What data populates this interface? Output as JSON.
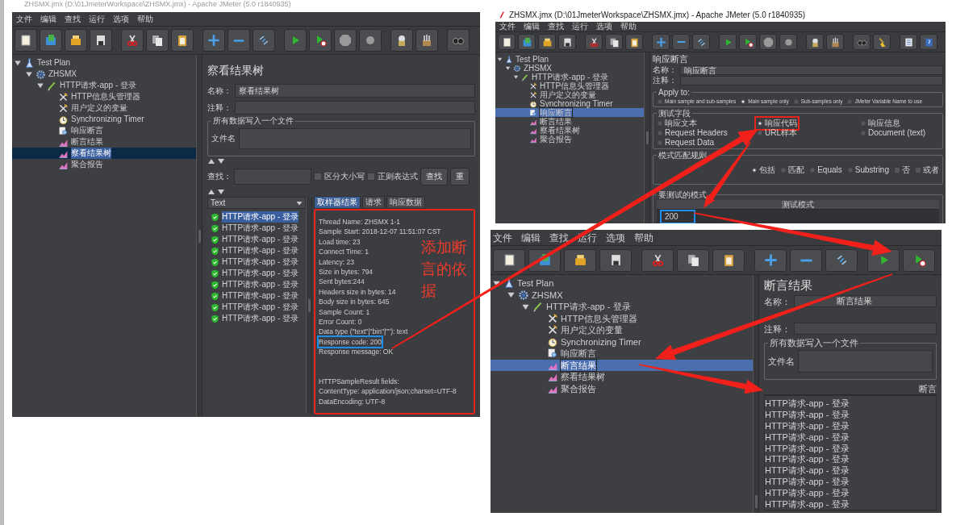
{
  "page_header": "ZHSMX.jmx (D:\\01JmeterWorkspace\\ZHSMX.jmx) - Apache JMeter (5.0 r1840935)",
  "windows": [
    {
      "kind": "view_results_tree",
      "menu": [
        "文件",
        "编辑",
        "查找",
        "运行",
        "选项",
        "帮助"
      ],
      "tree": [
        {
          "label": "Test Plan",
          "kind": "testplan",
          "expanded": true,
          "selected": false,
          "children": [
            {
              "label": "ZHSMX",
              "kind": "threadgroup",
              "expanded": true,
              "selected": false,
              "children": [
                {
                  "label": "HTTP请求-app - 登录",
                  "kind": "sampler",
                  "expanded": true,
                  "selected": false,
                  "children": [
                    {
                      "label": "HTTP信息头管理器",
                      "kind": "config",
                      "selected": false
                    },
                    {
                      "label": "用户定义的变量",
                      "kind": "config",
                      "selected": false
                    },
                    {
                      "label": "Synchronizing Timer",
                      "kind": "timer",
                      "selected": false
                    },
                    {
                      "label": "响应断言",
                      "kind": "assertion",
                      "selected": false
                    },
                    {
                      "label": "断言结果",
                      "kind": "listener",
                      "selected": false
                    },
                    {
                      "label": "察看结果树",
                      "kind": "listener",
                      "selected": true
                    },
                    {
                      "label": "聚合报告",
                      "kind": "listener",
                      "selected": false
                    }
                  ]
                }
              ]
            }
          ]
        }
      ],
      "panel": {
        "title": "察看结果树",
        "name_label": "名称：",
        "name_value": "察看结果树",
        "comment_label": "注释：",
        "file_legend": "所有数据写入一个文件",
        "file_label": "文件名",
        "search_label": "查找：",
        "search_options": [
          {
            "label": "区分大小写",
            "checked": false
          },
          {
            "label": "正则表达式",
            "checked": false
          }
        ],
        "buttons": [
          "查找",
          "重"
        ],
        "renderer": "Text",
        "results": [
          {
            "label": "HTTP请求-app - 登录",
            "selected": true
          },
          {
            "label": "HTTP请求-app - 登录",
            "selected": false
          },
          {
            "label": "HTTP请求-app - 登录",
            "selected": false
          },
          {
            "label": "HTTP请求-app - 登录",
            "selected": false
          },
          {
            "label": "HTTP请求-app - 登录",
            "selected": false
          },
          {
            "label": "HTTP请求-app - 登录",
            "selected": false
          },
          {
            "label": "HTTP请求-app - 登录",
            "selected": false
          },
          {
            "label": "HTTP请求-app - 登录",
            "selected": false
          },
          {
            "label": "HTTP请求-app - 登录",
            "selected": false
          },
          {
            "label": "HTTP请求-app - 登录",
            "selected": false
          }
        ],
        "tabs": [
          {
            "label": "取样器结果",
            "selected": true
          },
          {
            "label": "请求",
            "selected": false
          },
          {
            "label": "响应数据",
            "selected": false
          }
        ],
        "details_annotated": true,
        "details": [
          {
            "text": "Thread Name: ZHSMX 1-1",
            "annotated": false
          },
          {
            "text": "Sample Start: 2018-12-07 11:51:07 CST",
            "annotated": false
          },
          {
            "text": "Load time: 23",
            "annotated": false
          },
          {
            "text": "Connect Time: 1",
            "annotated": false
          },
          {
            "text": "Latency: 23",
            "annotated": false
          },
          {
            "text": "Size in bytes: 794",
            "annotated": false
          },
          {
            "text": "Sent bytes:244",
            "annotated": false
          },
          {
            "text": "Headers size in bytes: 14",
            "annotated": false
          },
          {
            "text": "Body size in bytes: 645",
            "annotated": false
          },
          {
            "text": "Sample Count: 1",
            "annotated": false
          },
          {
            "text": "Error Count: 0",
            "annotated": false
          },
          {
            "text": "Data type (\"text\"|\"bin\"|\"\"): text",
            "annotated": false
          },
          {
            "text": "Response code: 200",
            "annotated": true
          },
          {
            "text": "Response message: OK",
            "annotated": false
          }
        ],
        "details_fields": [
          "HTTPSampleResult fields:",
          "ContentType: application/json;charset=UTF-8",
          "DataEncoding: UTF-8"
        ],
        "annotation": "添加断言的依据"
      }
    },
    {
      "kind": "response_assertion",
      "title": "ZHSMX.jmx (D:\\01JmeterWorkspace\\ZHSMX.jmx) - Apache JMeter (5.0 r1840935)",
      "menu": [
        "文件",
        "编辑",
        "查找",
        "运行",
        "选项",
        "帮助"
      ],
      "tree": [
        {
          "label": "Test Plan",
          "kind": "testplan",
          "expanded": true,
          "selected": false,
          "children": [
            {
              "label": "ZHSMX",
              "kind": "threadgroup",
              "expanded": true,
              "selected": false,
              "children": [
                {
                  "label": "HTTP请求-app - 登录",
                  "kind": "sampler",
                  "expanded": true,
                  "selected": false,
                  "children": [
                    {
                      "label": "HTTP信息头管理器",
                      "kind": "config",
                      "selected": false
                    },
                    {
                      "label": "用户定义的变量",
                      "kind": "config",
                      "selected": false
                    },
                    {
                      "label": "Synchronizing Timer",
                      "kind": "timer",
                      "selected": false
                    },
                    {
                      "label": "响应断言",
                      "kind": "assertion",
                      "selected": true
                    },
                    {
                      "label": "断言结果",
                      "kind": "listener",
                      "selected": false
                    },
                    {
                      "label": "察看结果树",
                      "kind": "listener",
                      "selected": false
                    },
                    {
                      "label": "聚合报告",
                      "kind": "listener",
                      "selected": false
                    }
                  ]
                }
              ]
            }
          ]
        }
      ],
      "panel": {
        "title": "响应断言",
        "name_label": "名称：",
        "name_value": "响应断言",
        "comment_label": "注释：",
        "apply_legend": "Apply to:",
        "apply_options": [
          {
            "label": "Main sample and sub-samples",
            "selected": false
          },
          {
            "label": "Main sample only",
            "selected": true
          },
          {
            "label": "Sub-samples only",
            "selected": false
          },
          {
            "label": "JMeter Variable Name to use",
            "selected": false
          }
        ],
        "field_legend": "测试字段",
        "field_options": [
          {
            "label": "响应文本",
            "selected": false,
            "annotated": false
          },
          {
            "label": "响应代码",
            "selected": true,
            "annotated": true
          },
          {
            "label": "响应信息",
            "selected": false,
            "annotated": false
          },
          {
            "label": "Request Headers",
            "selected": false,
            "annotated": false
          },
          {
            "label": "URL样本",
            "selected": false,
            "annotated": false
          },
          {
            "label": "Document (text)",
            "selected": false,
            "annotated": false
          },
          {
            "label": "Request Data",
            "selected": false,
            "annotated": false
          }
        ],
        "rule_legend": "模式匹配规则",
        "rule_options": [
          {
            "label": "包括",
            "kind": "radio",
            "selected": true
          },
          {
            "label": "匹配",
            "kind": "radio",
            "selected": false
          },
          {
            "label": "Equals",
            "kind": "radio",
            "selected": false
          },
          {
            "label": "Substring",
            "kind": "radio",
            "selected": false
          },
          {
            "label": "否",
            "kind": "checkbox",
            "selected": false
          },
          {
            "label": "或者",
            "kind": "checkbox",
            "selected": false
          }
        ],
        "pattern_legend": "要测试的模式",
        "pattern_column": "测试模式",
        "patterns": [
          {
            "text": "200",
            "annotated": true
          }
        ]
      }
    },
    {
      "kind": "assertion_results",
      "menu": [
        "文件",
        "编辑",
        "查找",
        "运行",
        "选项",
        "帮助"
      ],
      "tree": [
        {
          "label": "Test Plan",
          "kind": "testplan",
          "expanded": true,
          "selected": false,
          "children": [
            {
              "label": "ZHSMX",
              "kind": "threadgroup",
              "expanded": true,
              "selected": false,
              "children": [
                {
                  "label": "HTTP请求-app - 登录",
                  "kind": "sampler",
                  "expanded": true,
                  "selected": false,
                  "children": [
                    {
                      "label": "HTTP信息头管理器",
                      "kind": "config",
                      "selected": false
                    },
                    {
                      "label": "用户定义的变量",
                      "kind": "config",
                      "selected": false
                    },
                    {
                      "label": "Synchronizing Timer",
                      "kind": "timer",
                      "selected": false
                    },
                    {
                      "label": "响应断言",
                      "kind": "assertion",
                      "selected": false
                    },
                    {
                      "label": "断言结果",
                      "kind": "listener",
                      "selected": true
                    },
                    {
                      "label": "察看结果树",
                      "kind": "listener",
                      "selected": false
                    },
                    {
                      "label": "聚合报告",
                      "kind": "listener",
                      "selected": false
                    }
                  ]
                }
              ]
            }
          ]
        }
      ],
      "panel": {
        "title": "断言结果",
        "name_label": "名称：",
        "name_value": "断言结果",
        "comment_label": "注释：",
        "file_legend": "所有数据写入一个文件",
        "file_label": "文件名",
        "column": "断言",
        "results": [
          "HTTP请求-app - 登录",
          "HTTP请求-app - 登录",
          "HTTP请求-app - 登录",
          "HTTP请求-app - 登录",
          "HTTP请求-app - 登录",
          "HTTP请求-app - 登录",
          "HTTP请求-app - 登录",
          "HTTP请求-app - 登录",
          "HTTP请求-app - 登录",
          "HTTP请求-app - 登录"
        ]
      }
    }
  ]
}
